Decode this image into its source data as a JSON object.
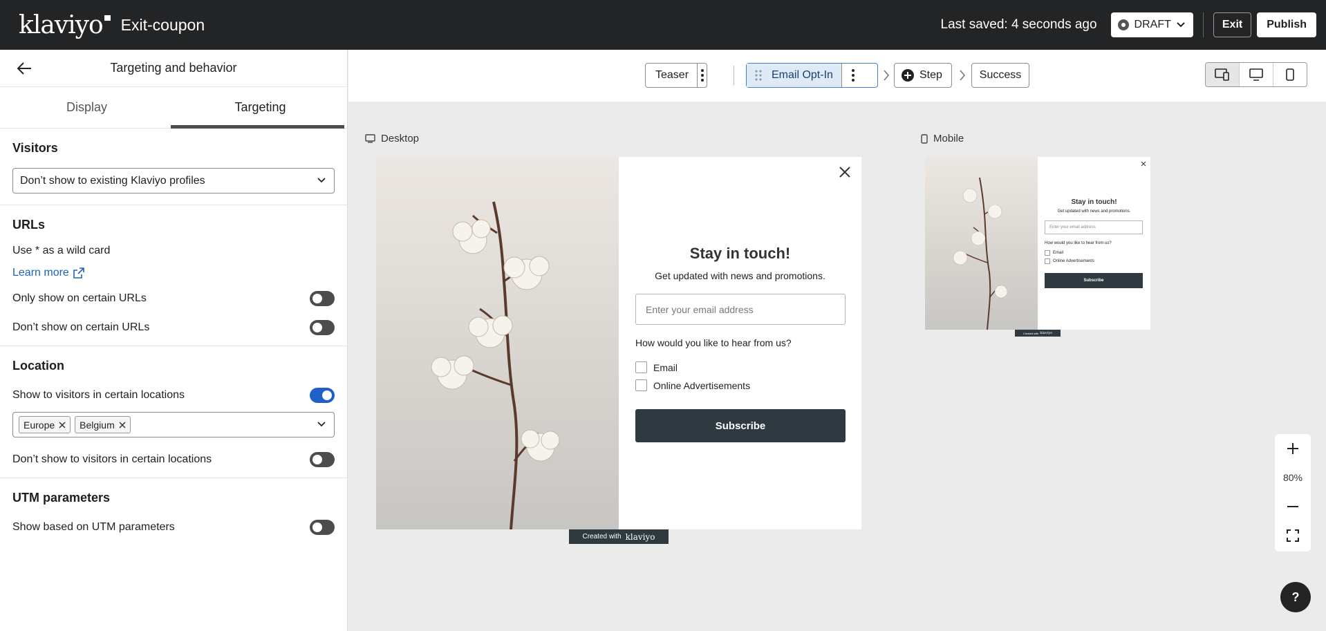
{
  "topbar": {
    "logo": "klaviyo",
    "title": "Exit-coupon",
    "saved_text": "Last saved: 4 seconds ago",
    "status": "DRAFT",
    "exit_label": "Exit",
    "publish_label": "Publish"
  },
  "panel": {
    "title": "Targeting and behavior",
    "tabs": [
      "Display",
      "Targeting"
    ],
    "active_tab": "Targeting",
    "visitors": {
      "title": "Visitors",
      "selected": "Don’t show to existing Klaviyo profiles"
    },
    "urls": {
      "title": "URLs",
      "hint": "Use * as a wild card",
      "learn_more": "Learn more",
      "only_show": "Only show on certain URLs",
      "dont_show": "Don’t show on certain URLs"
    },
    "location": {
      "title": "Location",
      "show_label": "Show to visitors in certain locations",
      "chips": [
        "Europe",
        "Belgium"
      ],
      "dont_show": "Don’t show to visitors in certain locations"
    },
    "utm": {
      "title": "UTM parameters",
      "show_label": "Show based on UTM parameters"
    },
    "toggles": {
      "only_show_urls": false,
      "dont_show_urls": false,
      "show_locations": true,
      "dont_show_locations": false,
      "utm": false
    }
  },
  "steps": {
    "teaser": "Teaser",
    "email_optin": "Email Opt-In",
    "add_step": "Step",
    "success": "Success"
  },
  "preview": {
    "desktop_label": "Desktop",
    "mobile_label": "Mobile",
    "form": {
      "title": "Stay in touch!",
      "subtitle": "Get updated with news and promotions.",
      "email_placeholder": "Enter your email address",
      "question": "How would you like to hear from us?",
      "options": [
        "Email",
        "Online Advertisements"
      ],
      "button": "Subscribe",
      "created_with": "Created with",
      "brand": "klaviyo"
    }
  },
  "zoom": {
    "level": "80%"
  },
  "help": "?"
}
